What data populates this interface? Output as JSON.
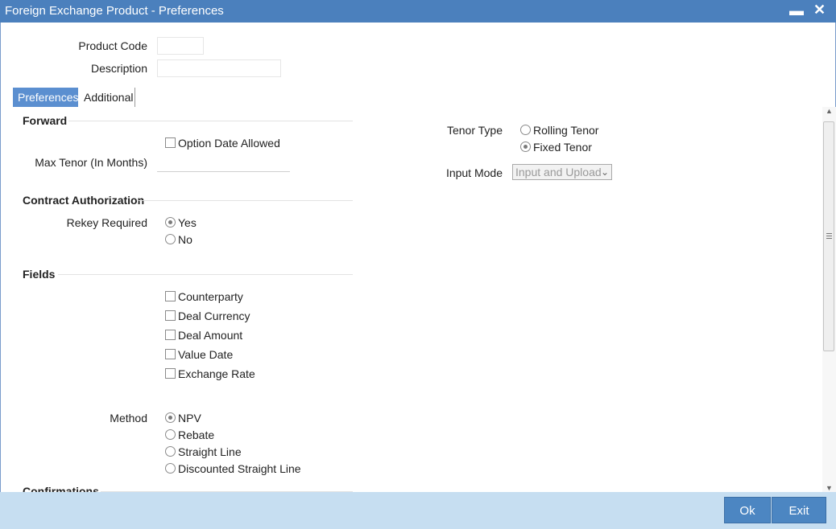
{
  "window": {
    "title": "Foreign Exchange Product - Preferences",
    "minimize_glyph": "▬",
    "close_glyph": "✕"
  },
  "header": {
    "product_code_label": "Product Code",
    "product_code_value": "",
    "description_label": "Description",
    "description_value": ""
  },
  "tabs": [
    {
      "label": "Preferences",
      "active": true
    },
    {
      "label": "Additional",
      "active": false
    }
  ],
  "forward": {
    "title": "Forward",
    "option_date_allowed": {
      "label": "Option Date Allowed",
      "checked": false
    },
    "max_tenor_label": "Max Tenor (In Months)",
    "max_tenor_value": ""
  },
  "tenor": {
    "label": "Tenor Type",
    "options": [
      {
        "label": "Rolling Tenor",
        "selected": false
      },
      {
        "label": "Fixed Tenor",
        "selected": true
      }
    ]
  },
  "input_mode": {
    "label": "Input Mode",
    "value": "Input and Upload",
    "arrow": "⌄"
  },
  "contract_authorization": {
    "title": "Contract Authorization",
    "rekey_label": "Rekey Required",
    "options": [
      {
        "label": "Yes",
        "selected": true
      },
      {
        "label": "No",
        "selected": false
      }
    ]
  },
  "fields": {
    "title": "Fields",
    "items": [
      {
        "label": "Counterparty",
        "checked": false
      },
      {
        "label": "Deal Currency",
        "checked": false
      },
      {
        "label": "Deal Amount",
        "checked": false
      },
      {
        "label": "Value Date",
        "checked": false
      },
      {
        "label": "Exchange Rate",
        "checked": false
      }
    ]
  },
  "method": {
    "label": "Method",
    "options": [
      {
        "label": "NPV",
        "selected": true
      },
      {
        "label": "Rebate",
        "selected": false
      },
      {
        "label": "Straight Line",
        "selected": false
      },
      {
        "label": "Discounted Straight Line",
        "selected": false
      }
    ]
  },
  "confirmations": {
    "title": "Confirmations"
  },
  "scrollbar": {
    "up_glyph": "▲",
    "down_glyph": "▼"
  },
  "footer": {
    "ok_label": "Ok",
    "exit_label": "Exit"
  }
}
